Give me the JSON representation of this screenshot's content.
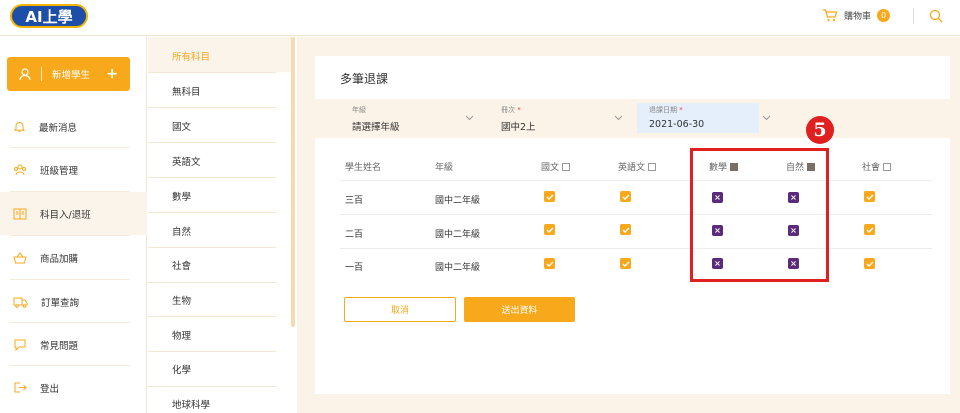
{
  "header": {
    "logo_text": "AI上學",
    "cart_label": "購物車",
    "cart_count": "0"
  },
  "sidebar": {
    "add_student": "新增學生",
    "items": [
      {
        "label": "最新消息",
        "icon": "bell-icon"
      },
      {
        "label": "班級管理",
        "icon": "group-icon"
      },
      {
        "label": "科目入/退班",
        "icon": "book-icon"
      },
      {
        "label": "商品加購",
        "icon": "basket-icon"
      },
      {
        "label": "訂單查詢",
        "icon": "truck-icon"
      },
      {
        "label": "常見問題",
        "icon": "chat-icon"
      },
      {
        "label": "登出",
        "icon": "logout-icon"
      }
    ]
  },
  "subjects": [
    "所有科目",
    "無科目",
    "國文",
    "英語文",
    "數學",
    "自然",
    "社會",
    "生物",
    "物理",
    "化學",
    "地球科學"
  ],
  "page_title": "多筆退課",
  "filters": {
    "grade_label": "年級",
    "grade_value": "請選擇年級",
    "volume_label": "冊次",
    "volume_value": "國中2上",
    "date_label": "退課日期",
    "date_value": "2021-06-30",
    "required_mark": "*"
  },
  "table": {
    "headers": [
      "學生姓名",
      "年級",
      "國文",
      "英語文",
      "數學",
      "自然",
      "社會"
    ],
    "rows": [
      {
        "name": "三百",
        "grade": "國中二年級"
      },
      {
        "name": "二百",
        "grade": "國中二年級"
      },
      {
        "name": "一百",
        "grade": "國中二年級"
      }
    ]
  },
  "annotation_number": "5",
  "buttons": {
    "cancel": "取消",
    "submit": "送出資料"
  },
  "colors": {
    "accent": "#f7a81b",
    "withdraw": "#5b2a7c",
    "annotation": "#e02020"
  }
}
